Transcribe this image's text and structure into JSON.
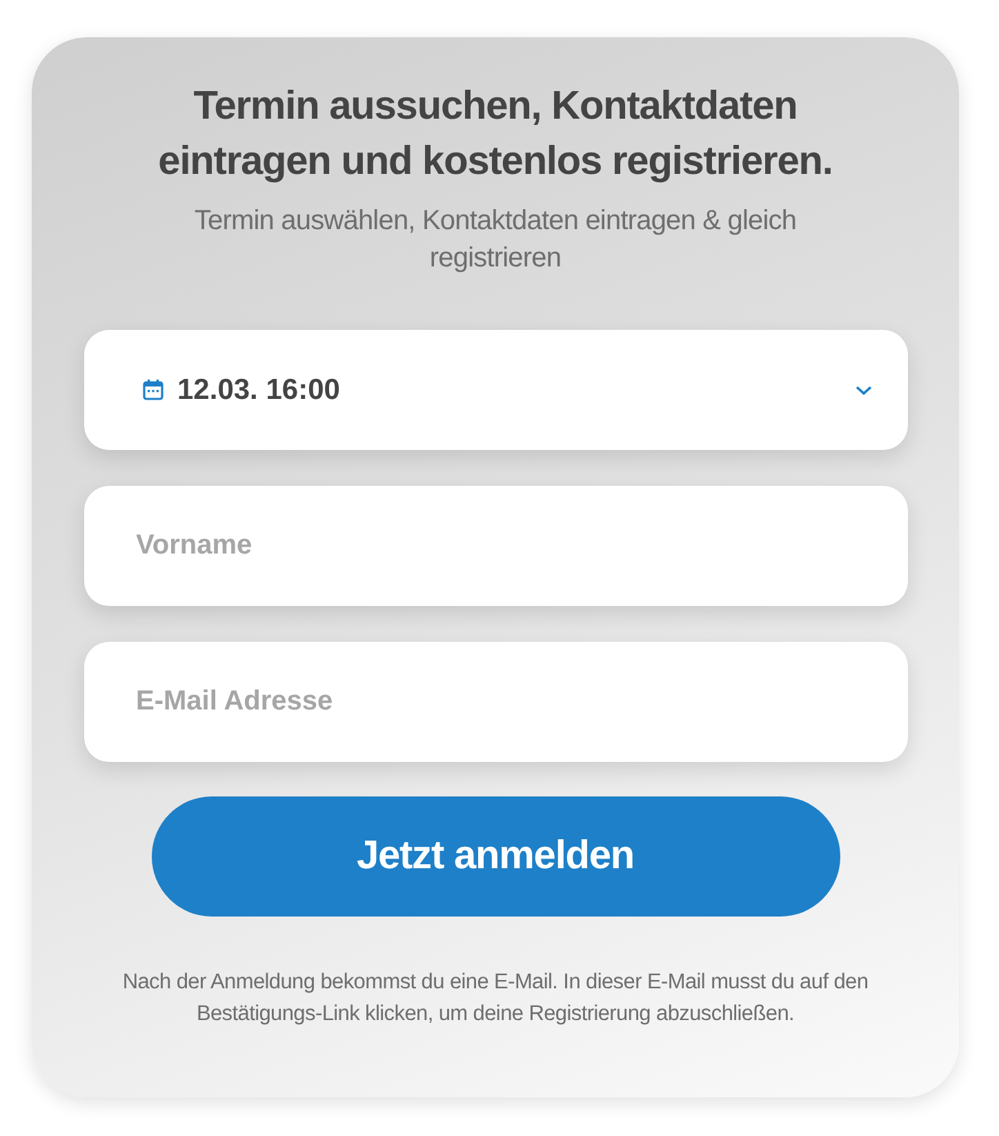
{
  "title": "Termin aussuchen, Kontaktdaten eintragen und kostenlos registrieren.",
  "subtitle": "Termin auswählen, Kontaktdaten eintragen & gleich registrieren",
  "fields": [
    {
      "kind": "select",
      "value": "12.03. 16:00"
    },
    {
      "kind": "text",
      "placeholder": "Vorname"
    },
    {
      "kind": "text",
      "placeholder": "E-Mail Adresse"
    }
  ],
  "submit": "Jetzt anmelden",
  "note": "Nach der Anmeldung bekommst du eine E-Mail. In dieser E-Mail musst du auf den Bestätigungs-Link klicken, um deine Registrierung abzuschließen."
}
